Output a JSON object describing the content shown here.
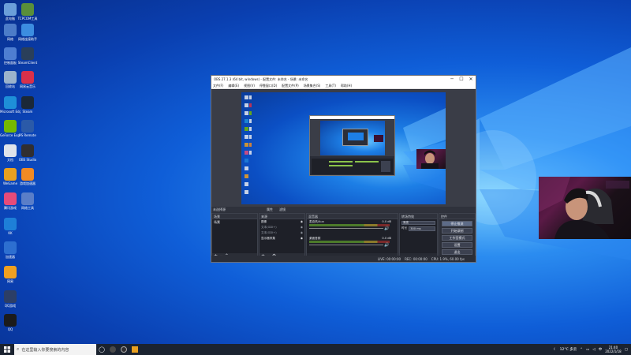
{
  "desktop": {
    "icons": [
      {
        "label": "此电脑",
        "glyph": "computer-icon",
        "color": "#6b9fd9"
      },
      {
        "label": "TCPCOM工具",
        "glyph": "wrench-icon",
        "color": "#5a8f3a"
      },
      {
        "label": "网络",
        "glyph": "network-icon",
        "color": "#4c7cc8"
      },
      {
        "label": "网络连接助手",
        "glyph": "wifi-icon",
        "color": "#3c8de0"
      },
      {
        "label": "控制面板",
        "glyph": "control-panel-icon",
        "color": "#4e7ed1"
      },
      {
        "label": "SteamClient",
        "glyph": "steam-app-icon",
        "color": "#2a3f5a"
      },
      {
        "label": "回收站",
        "glyph": "recycle-bin-icon",
        "color": "#9bb3cc"
      },
      {
        "label": "网易云音乐",
        "glyph": "music-icon",
        "color": "#d8304a"
      },
      {
        "label": "Microsoft Edge",
        "glyph": "edge-icon",
        "color": "#1e8fd8"
      },
      {
        "label": "Steam",
        "glyph": "steam-icon",
        "color": "#1b2838"
      },
      {
        "label": "GeForce Experience",
        "glyph": "nvidia-icon",
        "color": "#76b900"
      },
      {
        "label": "PS Remote",
        "glyph": "playstation-icon",
        "color": "#2b5aa8"
      },
      {
        "label": "文档",
        "glyph": "document-icon",
        "color": "#dfe3ea"
      },
      {
        "label": "OBS Studio",
        "glyph": "obs-icon",
        "color": "#302e31"
      },
      {
        "label": "WeGame",
        "glyph": "game-icon",
        "color": "#e8a020"
      },
      {
        "label": "游戏加速器",
        "glyph": "booster-icon",
        "color": "#f08a24"
      },
      {
        "label": "腾讯游戏",
        "glyph": "tencent-icon",
        "color": "#e64b7a"
      },
      {
        "label": "网络工具",
        "glyph": "tool-icon",
        "color": "#5a7ec8"
      },
      {
        "label": "KK",
        "glyph": "k-icon",
        "color": "#1e7fd8"
      },
      {
        "label": "加速器",
        "glyph": "shield-icon",
        "color": "#2d6fd0"
      },
      {
        "label": "网易",
        "glyph": "netease-icon",
        "color": "#f0a020"
      },
      {
        "label": "QQ游戏",
        "glyph": "qq-game-icon",
        "color": "#2c3e66"
      },
      {
        "label": "QQ",
        "glyph": "qq-icon",
        "color": "#1b1b1b"
      }
    ]
  },
  "obs": {
    "title": "OBS 27.1.3 (64 bit, windows) - 配置文件: 未命名 - 场景: 未命名",
    "menu": [
      "文件(F)",
      "编辑(E)",
      "视图(V)",
      "停靠窗口(D)",
      "配置文件(P)",
      "场景集合(S)",
      "工具(T)",
      "帮助(H)"
    ],
    "window_controls": {
      "minimize": "─",
      "maximize": "☐",
      "close": "✕"
    },
    "bar_label": "未选择源",
    "bar_buttons": [
      "属性",
      "滤镜"
    ],
    "docks": {
      "scenes": {
        "title": "场景",
        "items": [
          "场景"
        ]
      },
      "sources": {
        "title": "来源",
        "items": [
          "图像",
          "文本(GDI+)",
          "文本(GDI+)",
          "显示器采集"
        ]
      },
      "mixer": {
        "title": "混音器",
        "channels": [
          {
            "name": "麦克风/Aux",
            "db": "0.0 dB"
          },
          {
            "name": "桌面音频",
            "db": "0.0 dB"
          }
        ]
      },
      "transitions": {
        "title": "转场特效",
        "type": "渐变",
        "duration_label": "时长",
        "duration": "300 ms"
      },
      "controls": {
        "title": "控件",
        "buttons": [
          "停止推流",
          "开始录制",
          "工作室模式",
          "设置",
          "退出"
        ]
      }
    },
    "status": {
      "live": "LIVE: 00:00:00",
      "rec": "REC: 00:00:00",
      "cpu": "CPU: 1.9%, 60.00 fps"
    }
  },
  "taskbar": {
    "search_placeholder": "在这里输入你要搜索的内容",
    "weather": "12°C 多云",
    "ime": "中",
    "time": "21:40",
    "date": "2022/1/18"
  }
}
